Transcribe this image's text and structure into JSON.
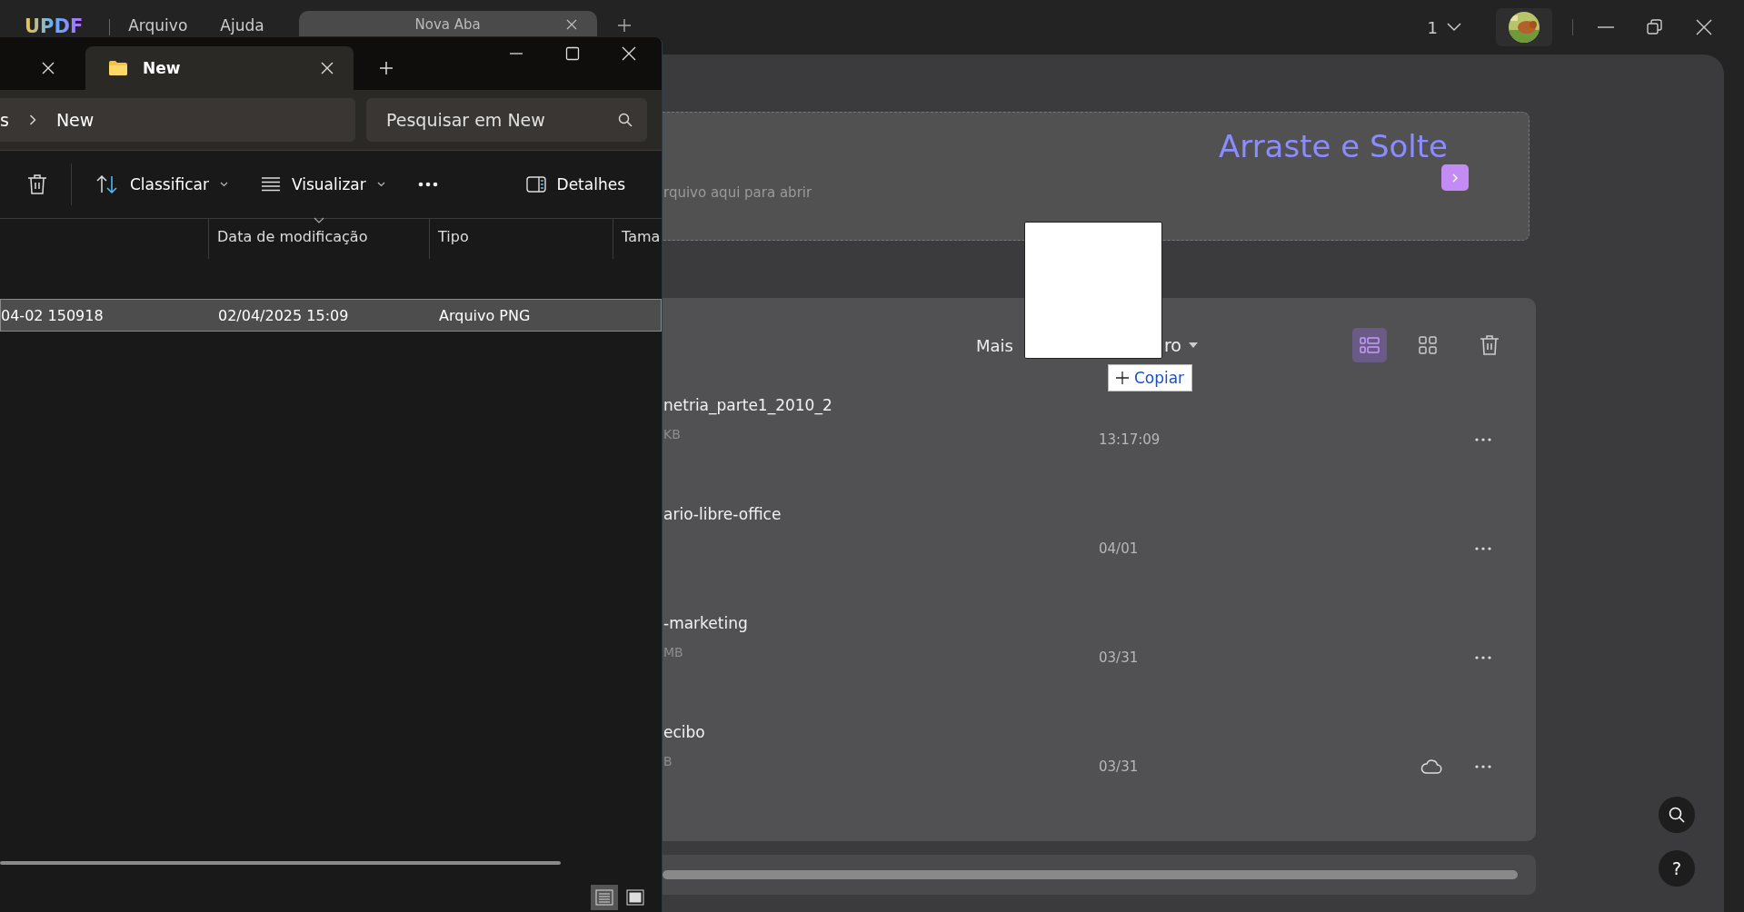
{
  "updf": {
    "logo": "UPDF",
    "menu": [
      "Arquivo",
      "Ajuda"
    ],
    "tabs": [
      {
        "label": "Nova Aba",
        "selected": true
      }
    ],
    "page_count": "1",
    "dropzone": {
      "title": "Arraste e Solte",
      "hint": "rquivo aqui para abrir"
    },
    "sort": {
      "label_start": "Mais",
      "label_end": "ro"
    },
    "views": [
      {
        "kind": "list",
        "selected": true
      },
      {
        "kind": "grid",
        "selected": false
      }
    ],
    "files": [
      {
        "name": "netria_parte1_2010_2",
        "size": "KB",
        "date": "13:17:09",
        "cloud": false
      },
      {
        "name": "ario-libre-office",
        "date": "04/01",
        "cloud": false
      },
      {
        "name": "-marketing",
        "size": "MB",
        "date": "03/31",
        "cloud": false
      },
      {
        "name": "ecibo",
        "size": "B",
        "date": "03/31",
        "cloud": true
      }
    ],
    "help": "?"
  },
  "explorer": {
    "tabs": [
      {
        "selected": false
      },
      {
        "label": "New",
        "selected": true
      }
    ],
    "breadcrumb": [
      "s",
      "New"
    ],
    "search": {
      "placeholder": "Pesquisar em New"
    },
    "toolbar": [
      "Classificar",
      "Visualizar"
    ],
    "details": "Detalhes",
    "columns": [
      {
        "label": "Data de modificação",
        "sorted": true
      },
      {
        "label": "Tipo",
        "sorted": false
      },
      {
        "label": "Tama",
        "sorted": false
      }
    ],
    "rows": [
      {
        "name": "04-02 150918",
        "date": "02/04/2025 15:09",
        "type": "Arquivo PNG",
        "selected": true
      }
    ],
    "view_modes": [
      {
        "kind": "details",
        "selected": true
      },
      {
        "kind": "tiles",
        "selected": false
      }
    ]
  },
  "drag": {
    "action": "Copiar"
  }
}
